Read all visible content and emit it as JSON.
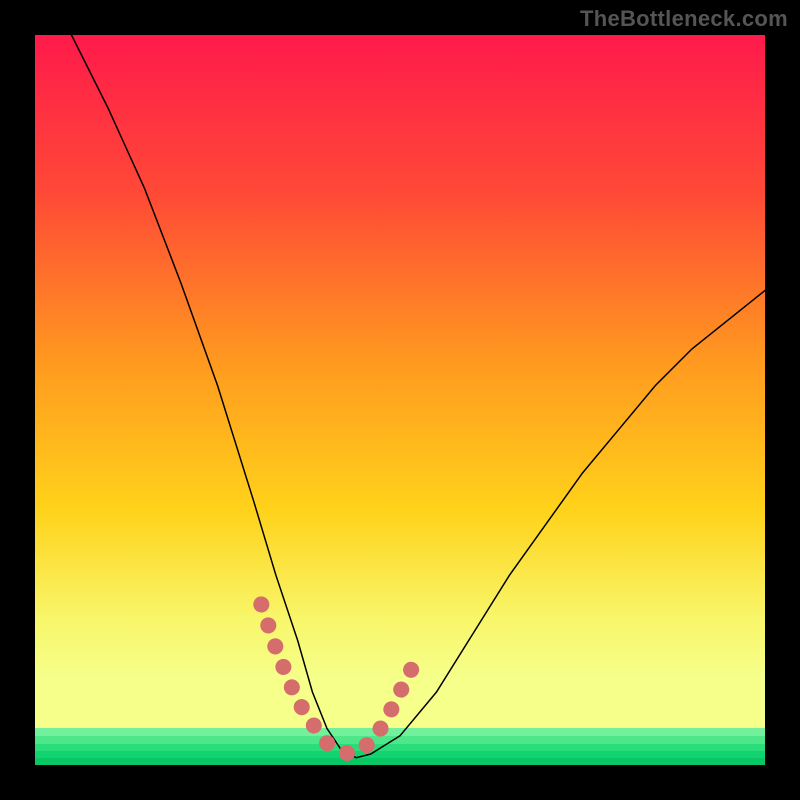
{
  "watermark": "TheBottleneck.com",
  "chart_data": {
    "type": "line",
    "title": "",
    "xlabel": "",
    "ylabel": "",
    "xlim": [
      0,
      100
    ],
    "ylim": [
      0,
      100
    ],
    "background_gradient": {
      "top": "#ff1a4b",
      "mid1": "#ff6a2a",
      "mid2": "#ffd21a",
      "bottom_band_top": "#f6ff8a",
      "bottom": "#07c865"
    },
    "series": [
      {
        "name": "bottleneck-curve",
        "x": [
          5,
          10,
          15,
          20,
          25,
          30,
          33,
          36,
          38,
          40,
          42,
          44,
          46,
          50,
          55,
          60,
          65,
          70,
          75,
          80,
          85,
          90,
          95,
          100
        ],
        "y": [
          100,
          90,
          79,
          66,
          52,
          36,
          26,
          17,
          10,
          5,
          2,
          1,
          1.5,
          4,
          10,
          18,
          26,
          33,
          40,
          46,
          52,
          57,
          61,
          65
        ]
      }
    ],
    "overlay_markers": {
      "name": "pink-dots",
      "color": "#d66d6d",
      "x": [
        31,
        33,
        35,
        37,
        40,
        43,
        46,
        48,
        50,
        52
      ],
      "y": [
        22,
        16,
        11,
        7,
        3,
        1.5,
        3,
        6,
        10,
        14
      ]
    },
    "annotations": []
  }
}
